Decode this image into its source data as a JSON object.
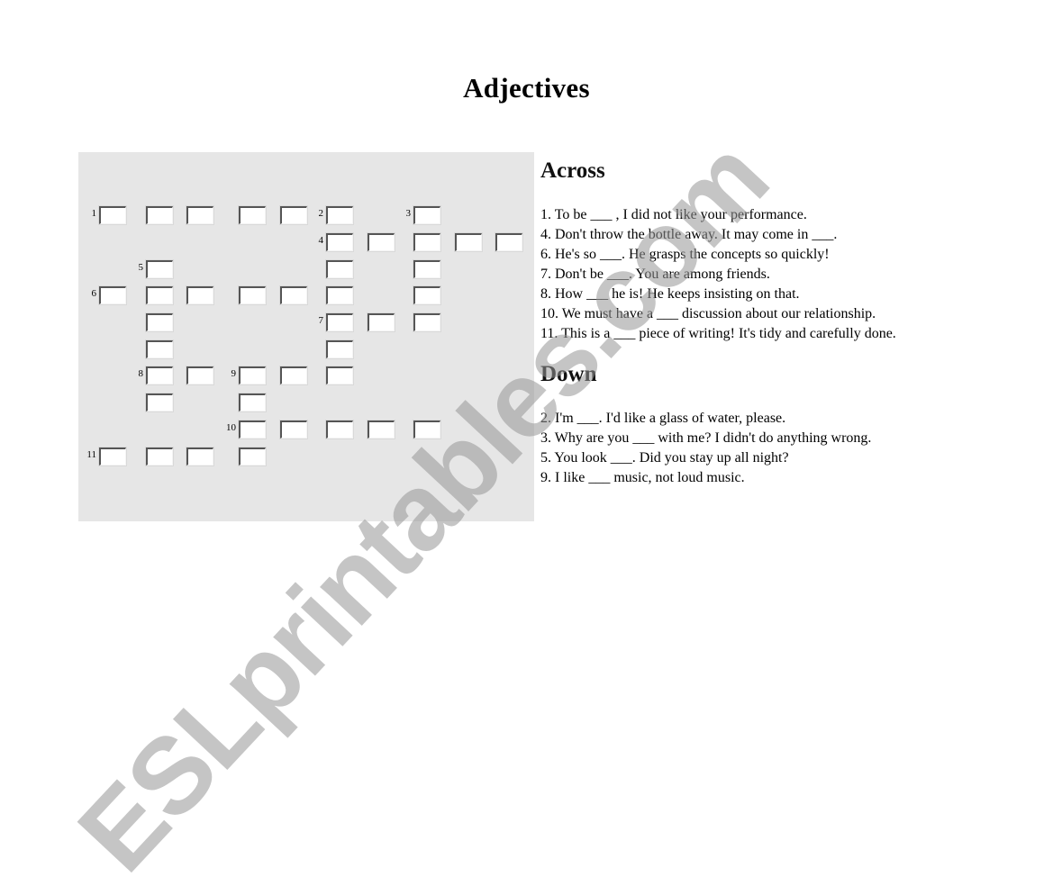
{
  "title": "Adjectives",
  "across": {
    "heading": "Across",
    "clues": [
      "1. To be ___ , I did not like your performance.",
      "4. Don't throw the bottle away. It may come in ___.",
      "6. He's so ___. He grasps the concepts so quickly!",
      "7. Don't be ___.  You are among friends.",
      "8. How ___ he is! He keeps insisting on that.",
      "10. We must have a ___ discussion about our relationship.",
      "11. This is a ___ piece of writing! It's tidy and carefully done."
    ]
  },
  "down": {
    "heading": "Down",
    "clues": [
      "2. I'm ___. I'd like a glass of water, please.",
      "3. Why are you ___ with me? I didn't do anything wrong.",
      "5. You look ___. Did you stay up all night?",
      "9. I like ___ music, not loud music."
    ]
  },
  "grid": {
    "numbers": [
      {
        "label": "1",
        "row": 0,
        "col": 0
      },
      {
        "label": "2",
        "row": 0,
        "col": 5
      },
      {
        "label": "3",
        "row": 0,
        "col": 7
      },
      {
        "label": "4",
        "row": 1,
        "col": 5
      },
      {
        "label": "5",
        "row": 2,
        "col": 1
      },
      {
        "label": "6",
        "row": 3,
        "col": 0
      },
      {
        "label": "7",
        "row": 4,
        "col": 5
      },
      {
        "label": "8",
        "row": 6,
        "col": 1
      },
      {
        "label": "9",
        "row": 6,
        "col": 3
      },
      {
        "label": "10",
        "row": 8,
        "col": 3
      },
      {
        "label": "11",
        "row": 9,
        "col": 0
      }
    ],
    "cells": [
      [
        0,
        0
      ],
      [
        0,
        1
      ],
      [
        0,
        2
      ],
      [
        0,
        3
      ],
      [
        0,
        4
      ],
      [
        0,
        5
      ],
      [
        0,
        7
      ],
      [
        1,
        5
      ],
      [
        1,
        6
      ],
      [
        1,
        7
      ],
      [
        1,
        8
      ],
      [
        1,
        9
      ],
      [
        2,
        1
      ],
      [
        2,
        5
      ],
      [
        2,
        7
      ],
      [
        3,
        0
      ],
      [
        3,
        1
      ],
      [
        3,
        2
      ],
      [
        3,
        3
      ],
      [
        3,
        4
      ],
      [
        3,
        5
      ],
      [
        3,
        7
      ],
      [
        4,
        1
      ],
      [
        4,
        5
      ],
      [
        4,
        6
      ],
      [
        4,
        7
      ],
      [
        5,
        1
      ],
      [
        5,
        5
      ],
      [
        6,
        1
      ],
      [
        6,
        2
      ],
      [
        6,
        3
      ],
      [
        6,
        4
      ],
      [
        6,
        5
      ],
      [
        7,
        1
      ],
      [
        7,
        3
      ],
      [
        8,
        3
      ],
      [
        8,
        4
      ],
      [
        8,
        5
      ],
      [
        8,
        6
      ],
      [
        8,
        7
      ],
      [
        9,
        0
      ],
      [
        9,
        1
      ],
      [
        9,
        2
      ],
      [
        9,
        3
      ]
    ]
  },
  "watermark": "ESLprintables.com"
}
